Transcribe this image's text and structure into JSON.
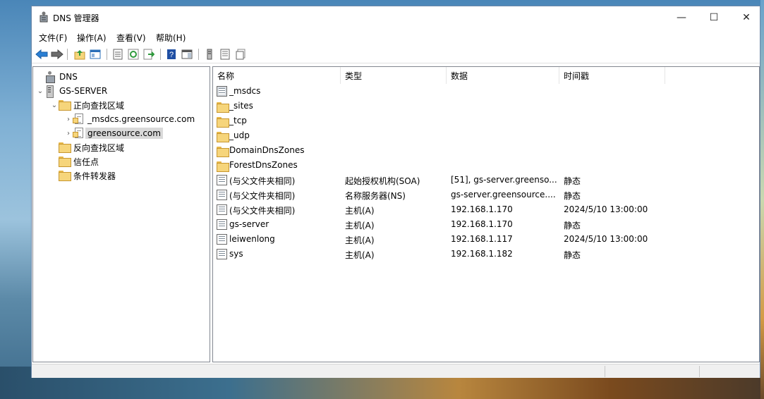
{
  "window": {
    "title": "DNS 管理器"
  },
  "titlebar_buttons": {
    "minimize": "—",
    "maximize": "☐",
    "close": "✕"
  },
  "menu": [
    "文件(F)",
    "操作(A)",
    "查看(V)",
    "帮助(H)"
  ],
  "toolbar": [
    {
      "name": "back-icon"
    },
    {
      "name": "forward-icon"
    },
    {
      "name": "up-folder-icon"
    },
    {
      "name": "show-hide-console-tree-icon"
    },
    {
      "name": "properties-icon"
    },
    {
      "name": "refresh-icon"
    },
    {
      "name": "export-list-icon"
    },
    {
      "name": "help-icon"
    },
    {
      "name": "show-action-pane-icon"
    },
    {
      "name": "server-icon"
    },
    {
      "name": "record-icon"
    },
    {
      "name": "copy-record-icon"
    }
  ],
  "tree": [
    {
      "label": "DNS",
      "icon": "dns-icon",
      "level": 0,
      "expander": ""
    },
    {
      "label": "GS-SERVER",
      "icon": "server-icon",
      "level": 1,
      "expander": "⌄"
    },
    {
      "label": "正向查找区域",
      "icon": "folder-icon",
      "level": 2,
      "expander": "⌄"
    },
    {
      "label": "_msdcs.greensource.com",
      "icon": "zone-icon",
      "level": 3,
      "expander": "›"
    },
    {
      "label": "greensource.com",
      "icon": "zone-icon",
      "level": 3,
      "expander": "›",
      "selected": true
    },
    {
      "label": "反向查找区域",
      "icon": "folder-icon",
      "level": 2,
      "expander": ""
    },
    {
      "label": "信任点",
      "icon": "folder-icon",
      "level": 2,
      "expander": ""
    },
    {
      "label": "条件转发器",
      "icon": "folder-icon",
      "level": 2,
      "expander": ""
    }
  ],
  "columns": [
    "名称",
    "类型",
    "数据",
    "时间戳"
  ],
  "rows": [
    {
      "name": "_msdcs",
      "type": "",
      "data": "",
      "timestamp": "",
      "icon": "delegated-folder-icon"
    },
    {
      "name": "_sites",
      "type": "",
      "data": "",
      "timestamp": "",
      "icon": "folder-icon"
    },
    {
      "name": "_tcp",
      "type": "",
      "data": "",
      "timestamp": "",
      "icon": "folder-icon"
    },
    {
      "name": "_udp",
      "type": "",
      "data": "",
      "timestamp": "",
      "icon": "folder-icon"
    },
    {
      "name": "DomainDnsZones",
      "type": "",
      "data": "",
      "timestamp": "",
      "icon": "folder-icon"
    },
    {
      "name": "ForestDnsZones",
      "type": "",
      "data": "",
      "timestamp": "",
      "icon": "folder-icon"
    },
    {
      "name": "(与父文件夹相同)",
      "type": "起始授权机构(SOA)",
      "data": "[51], gs-server.greenso...",
      "timestamp": "静态",
      "icon": "record-icon"
    },
    {
      "name": "(与父文件夹相同)",
      "type": "名称服务器(NS)",
      "data": "gs-server.greensource....",
      "timestamp": "静态",
      "icon": "record-icon"
    },
    {
      "name": "(与父文件夹相同)",
      "type": "主机(A)",
      "data": "192.168.1.170",
      "timestamp": "2024/5/10 13:00:00",
      "icon": "record-icon"
    },
    {
      "name": "gs-server",
      "type": "主机(A)",
      "data": "192.168.1.170",
      "timestamp": "静态",
      "icon": "record-icon"
    },
    {
      "name": "leiwenlong",
      "type": "主机(A)",
      "data": "192.168.1.117",
      "timestamp": "2024/5/10 13:00:00",
      "icon": "record-icon"
    },
    {
      "name": "sys",
      "type": "主机(A)",
      "data": "192.168.1.182",
      "timestamp": "静态",
      "icon": "record-icon"
    }
  ]
}
